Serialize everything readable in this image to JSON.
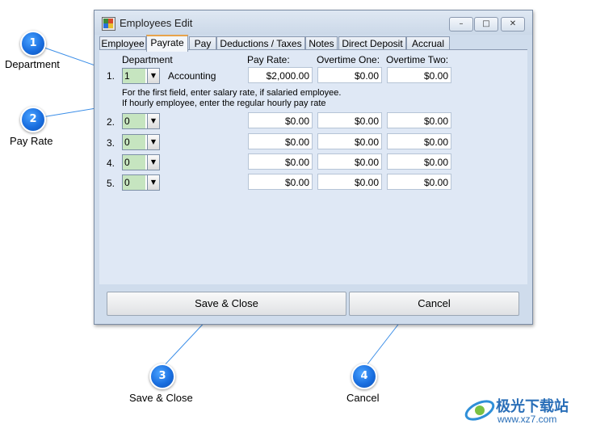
{
  "window": {
    "title": "Employees Edit",
    "buttons": {
      "minimize": "–",
      "maximize": "□",
      "close": "✕"
    }
  },
  "tabs": [
    "Employee",
    "Payrate",
    "Pay",
    "Deductions / Taxes",
    "Notes",
    "Direct Deposit",
    "Accrual"
  ],
  "active_tab": "Payrate",
  "headers": {
    "department": "Department",
    "pay_rate": "Pay Rate:",
    "overtime_one": "Overtime One:",
    "overtime_two": "Overtime Two:"
  },
  "rows": [
    {
      "num": "1.",
      "dept": "1",
      "dept_name": "Accounting",
      "pay_rate": "$2,000.00",
      "ot1": "$0.00",
      "ot2": "$0.00"
    },
    {
      "num": "2.",
      "dept": "0",
      "dept_name": "",
      "pay_rate": "$0.00",
      "ot1": "$0.00",
      "ot2": "$0.00"
    },
    {
      "num": "3.",
      "dept": "0",
      "dept_name": "",
      "pay_rate": "$0.00",
      "ot1": "$0.00",
      "ot2": "$0.00"
    },
    {
      "num": "4.",
      "dept": "0",
      "dept_name": "",
      "pay_rate": "$0.00",
      "ot1": "$0.00",
      "ot2": "$0.00"
    },
    {
      "num": "5.",
      "dept": "0",
      "dept_name": "",
      "pay_rate": "$0.00",
      "ot1": "$0.00",
      "ot2": "$0.00"
    }
  ],
  "note": {
    "line1": "For the first field, enter salary rate, if salaried employee.",
    "line2": "If hourly employee, enter the regular hourly pay rate"
  },
  "buttons": {
    "save_close": "Save & Close",
    "cancel": "Cancel"
  },
  "callouts": [
    {
      "num": "1",
      "label": "Department"
    },
    {
      "num": "2",
      "label": "Pay Rate"
    },
    {
      "num": "3",
      "label": "Save & Close"
    },
    {
      "num": "4",
      "label": "Cancel"
    }
  ],
  "watermark": {
    "text_cn": "极光下载站",
    "url": "www.xz7.com"
  },
  "colors": {
    "dept_field": "#c6e5c0",
    "callout_blue": "#1a6fe0",
    "window_bg": "#cfdcec",
    "active_tab_accent": "#e8a34a"
  }
}
